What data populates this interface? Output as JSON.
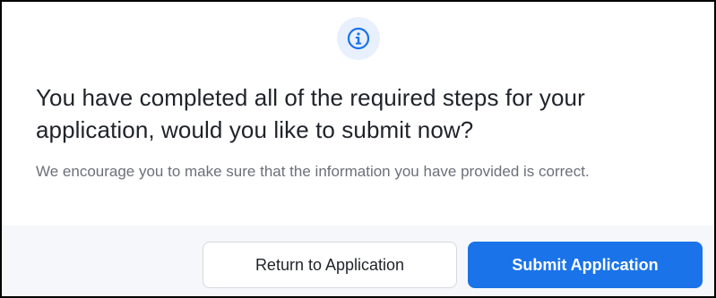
{
  "dialog": {
    "icon": "info-circle-icon",
    "title": "You have completed all of the required steps for your application, would you like to submit now?",
    "message": "We encourage you to make sure that the information you have provided is correct.",
    "buttons": {
      "secondary_label": "Return to Application",
      "primary_label": "Submit Application"
    }
  },
  "colors": {
    "primary": "#1a73e8",
    "icon_background": "#e8effd",
    "footer_background": "#f5f7fa",
    "title_text": "#1f2329",
    "message_text": "#6b7078"
  }
}
